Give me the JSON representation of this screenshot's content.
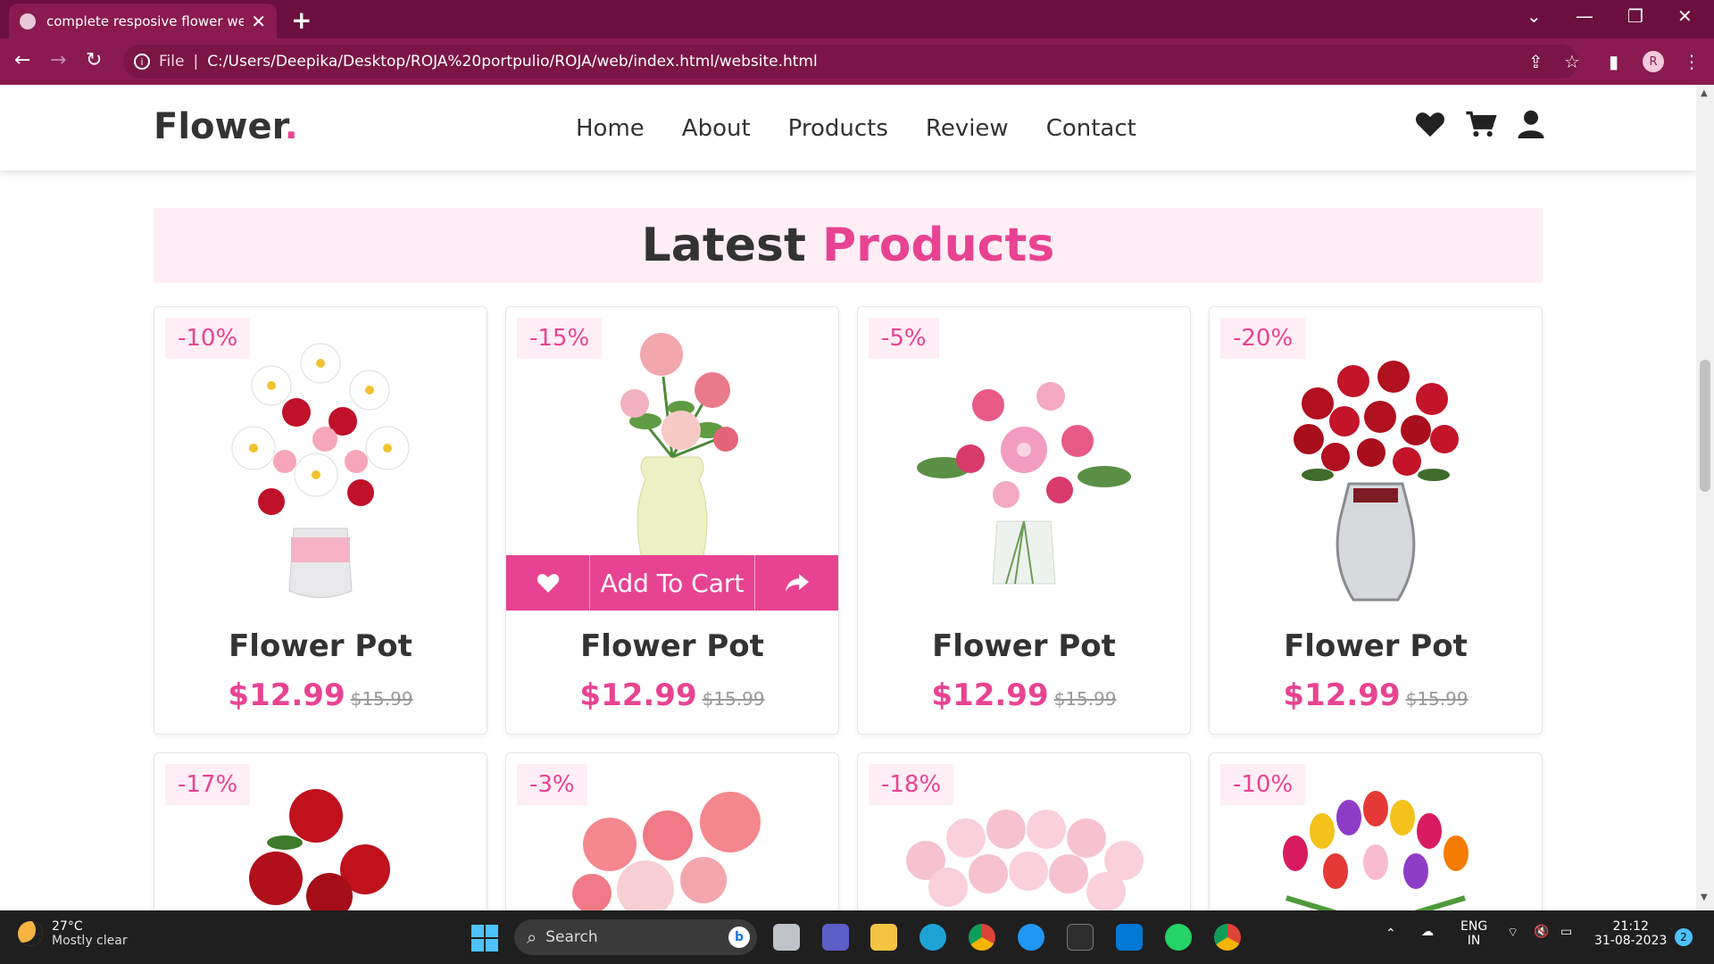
{
  "browser": {
    "tab_title": "complete resposive flower website",
    "url_scheme": "File",
    "url": "C:/Users/Deepika/Desktop/ROJA%20portpulio/ROJA/web/index.html/website.html",
    "profile_initial": "R"
  },
  "site": {
    "logo": "Flower",
    "logo_dot": ".",
    "nav": [
      "Home",
      "About",
      "Products",
      "Review",
      "Contact"
    ],
    "heading_part1": "Latest",
    "heading_part2": "Products",
    "add_to_cart": "Add To Cart",
    "products": [
      {
        "discount": "-10%",
        "name": "Flower Pot",
        "price": "$12.99",
        "old_price": "$15.99"
      },
      {
        "discount": "-15%",
        "name": "Flower Pot",
        "price": "$12.99",
        "old_price": "$15.99"
      },
      {
        "discount": "-5%",
        "name": "Flower Pot",
        "price": "$12.99",
        "old_price": "$15.99"
      },
      {
        "discount": "-20%",
        "name": "Flower Pot",
        "price": "$12.99",
        "old_price": "$15.99"
      },
      {
        "discount": "-17%"
      },
      {
        "discount": "-3%"
      },
      {
        "discount": "-18%"
      },
      {
        "discount": "-10%"
      }
    ],
    "colors": {
      "accent": "#e84393",
      "heading_bg": "#ffeef6",
      "browser": "#8a1a4f"
    }
  },
  "taskbar": {
    "temp": "27°C",
    "weather": "Mostly clear",
    "search": "Search",
    "lang1": "ENG",
    "lang2": "IN",
    "time": "21:12",
    "date": "31-08-2023",
    "notif": "2"
  }
}
